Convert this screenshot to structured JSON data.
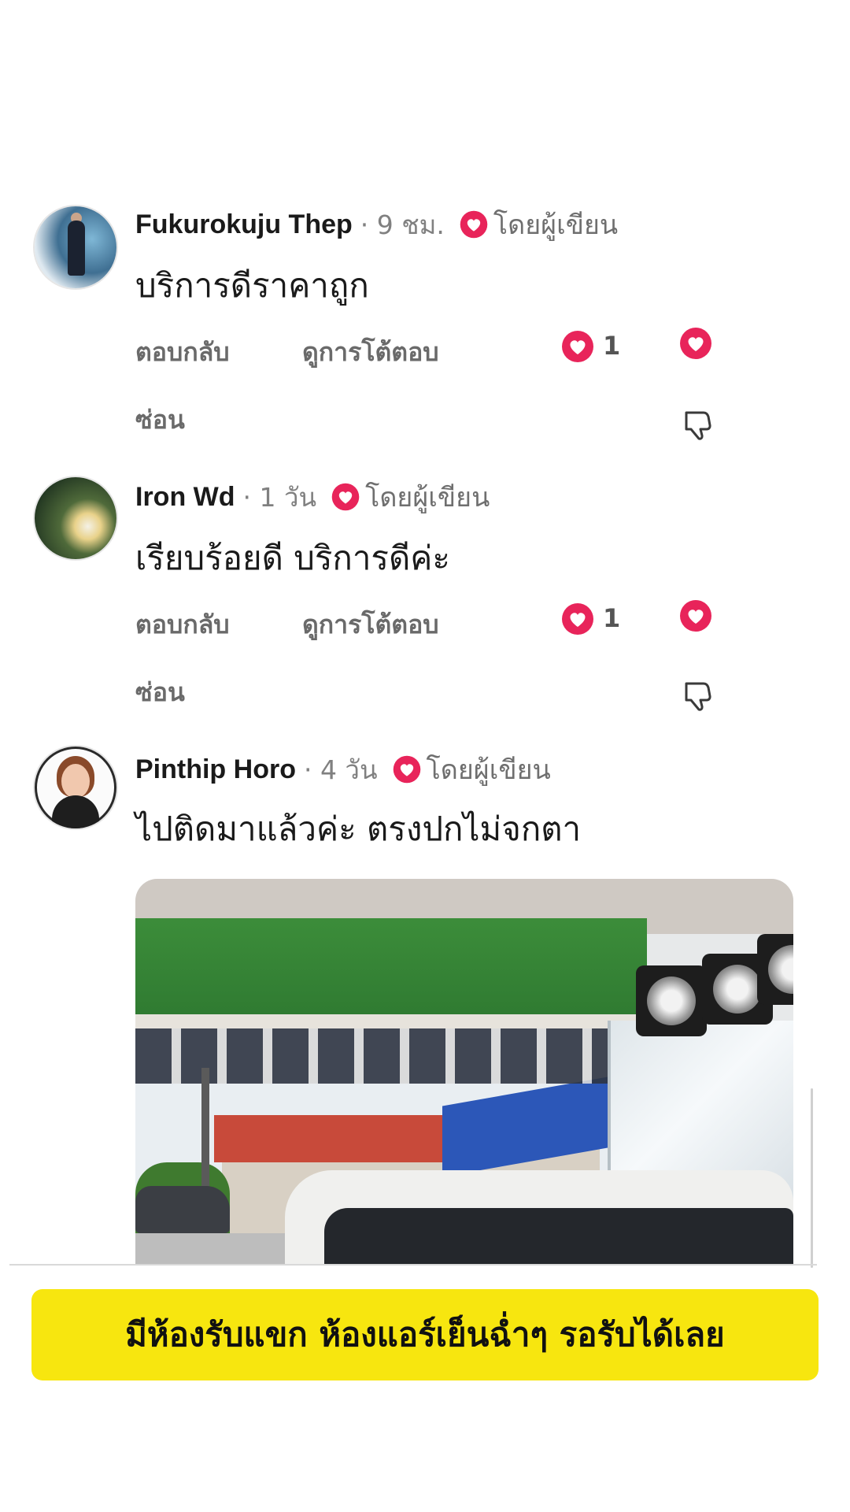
{
  "comments": [
    {
      "author": "Fukurokuju Thep",
      "time": "· 9 ชม.",
      "by_author": "โดยผู้เขียน",
      "text": "บริการดีราคาถูก",
      "reply_label": "ตอบกลับ",
      "view_replies_label": "ดูการโต้ตอบ",
      "like_count": "1",
      "hide_label": "ซ่อน"
    },
    {
      "author": "Iron Wd",
      "time": "· 1 วัน",
      "by_author": "โดยผู้เขียน",
      "text": "เรียบร้อยดี บริการดีค่ะ",
      "reply_label": "ตอบกลับ",
      "view_replies_label": "ดูการโต้ตอบ",
      "like_count": "1",
      "hide_label": "ซ่อน"
    },
    {
      "author": "Pinthip Horo",
      "time": "· 4 วัน",
      "by_author": "โดยผู้เขียน",
      "text": "ไปติดมาแล้วค่ะ ตรงปกไม่จกตา"
    }
  ],
  "caption": "มีห้องรับแขก ห้องแอร์เย็นฉ่ำๆ รอรับได้เลย",
  "colors": {
    "heart": "#e8245a",
    "caption_bg": "#f7e60f",
    "action_text": "#6a6a6a"
  },
  "icons": {
    "heart": "heart-icon",
    "dislike": "thumbs-down-icon"
  }
}
